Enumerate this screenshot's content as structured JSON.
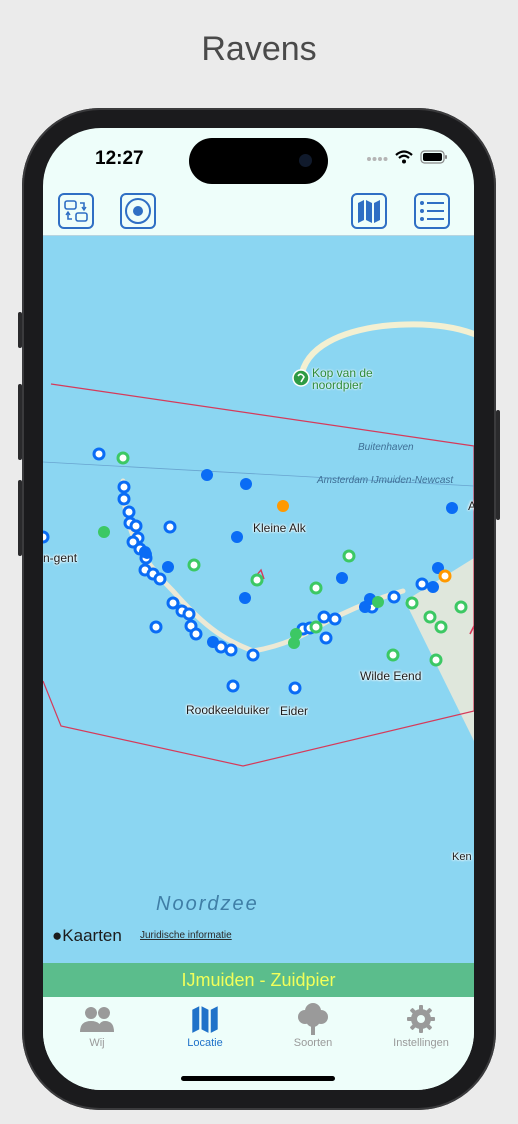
{
  "page": {
    "title": "Ravens"
  },
  "status_bar": {
    "time": "12:27"
  },
  "toolbar": {
    "switch_icon": "switch-icon",
    "target_icon": "target-icon",
    "map_icon": "map-icon",
    "list_icon": "list-icon"
  },
  "map": {
    "labels": {
      "kleine_alk": "Kleine Alk",
      "wilde_eend": "Wilde Eend",
      "roodkeelduiker": "Roodkeelduiker",
      "eider": "Eider",
      "gent": "n-gent",
      "a_cut": "A",
      "ken_cut": "Ken"
    },
    "water_labels": {
      "buitenhaven": "Buitenhaven",
      "ferry": "Amsterdam IJmuiden-Newcast",
      "noordzee": "Noordzee"
    },
    "poi": {
      "line1": "Kop van de",
      "line2": "noordpier"
    },
    "attribution": {
      "brand": "Kaarten",
      "legal": "Juridische informatie"
    },
    "colors": {
      "water": "#8bd6f2",
      "land": "#dfe7dc",
      "blue": "#0a6cf5",
      "green": "#3cc864",
      "orange": "#ff9900",
      "boundary": "#d63a5a"
    }
  },
  "location_bar": {
    "name": "IJmuiden - Zuidpier",
    "color": "#5bbd8c",
    "text_color": "#f1ff5a"
  },
  "tabs": [
    {
      "label": "Wij",
      "icon": "people-icon",
      "active": false
    },
    {
      "label": "Locatie",
      "icon": "map-icon",
      "active": true
    },
    {
      "label": "Soorten",
      "icon": "tree-icon",
      "active": false
    },
    {
      "label": "Instellingen",
      "icon": "gear-icon",
      "active": false
    }
  ]
}
